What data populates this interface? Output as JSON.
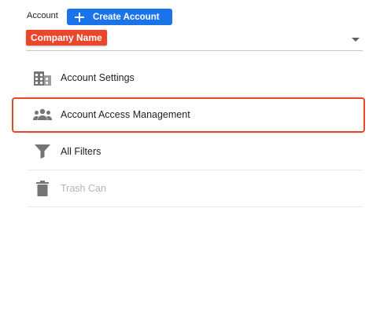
{
  "header": {
    "account_label": "Account",
    "create_button_label": "Create Account"
  },
  "account_select": {
    "selected_value": "Company Name"
  },
  "menu": {
    "items": [
      {
        "label": "Account Settings",
        "icon": "building-icon",
        "disabled": false
      },
      {
        "label": "Account Access Management",
        "icon": "people-icon",
        "disabled": false,
        "highlighted": true
      },
      {
        "label": "All Filters",
        "icon": "filter-icon",
        "disabled": false
      },
      {
        "label": "Trash Can",
        "icon": "trash-icon",
        "disabled": true
      }
    ]
  },
  "colors": {
    "primary_button": "#1a73e8",
    "badge_red": "#e8472c",
    "highlight_red": "#e8472c",
    "icon_gray": "#757575",
    "disabled_gray": "#b5b5b5"
  }
}
